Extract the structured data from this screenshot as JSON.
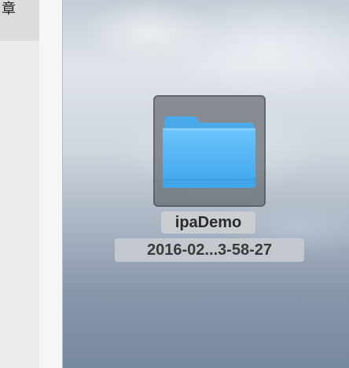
{
  "left_window": {
    "visible_text": "章"
  },
  "desktop_item": {
    "name": "ipaDemo",
    "subtitle": "2016-02...3-58-27",
    "icon": "folder-icon",
    "selected": true
  },
  "colors": {
    "folder_blue": "#5ab8f5",
    "selection_gray": "#555a5f"
  }
}
